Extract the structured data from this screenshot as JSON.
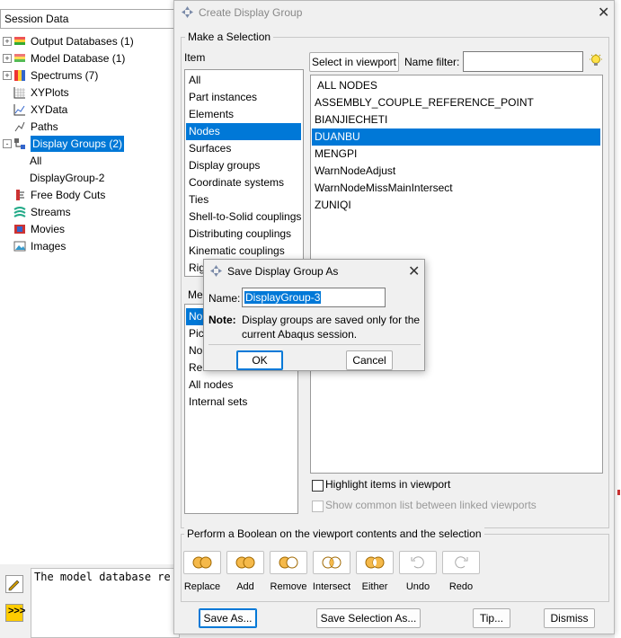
{
  "session": {
    "header": "Session Data",
    "tree": [
      {
        "label": "Output Databases (1)",
        "icon": "database-icon",
        "expand": "+"
      },
      {
        "label": "Model Database (1)",
        "icon": "model-database-icon",
        "expand": "+"
      },
      {
        "label": "Spectrums (7)",
        "icon": "spectrum-icon",
        "expand": "+"
      },
      {
        "label": "XYPlots",
        "icon": "xyplot-icon",
        "expand": ""
      },
      {
        "label": "XYData",
        "icon": "xydata-icon",
        "expand": ""
      },
      {
        "label": "Paths",
        "icon": "path-icon",
        "expand": ""
      },
      {
        "label": "Display Groups (2)",
        "icon": "display-groups-icon",
        "expand": "-"
      },
      {
        "label": "All",
        "icon": "",
        "expand": ""
      },
      {
        "label": "DisplayGroup-2",
        "icon": "",
        "expand": ""
      },
      {
        "label": "Free Body Cuts",
        "icon": "free-body-cut-icon",
        "expand": ""
      },
      {
        "label": "Streams",
        "icon": "stream-icon",
        "expand": ""
      },
      {
        "label": "Movies",
        "icon": "movie-icon",
        "expand": ""
      },
      {
        "label": "Images",
        "icon": "image-icon",
        "expand": ""
      }
    ]
  },
  "command": {
    "text": "The model database re"
  },
  "dialog": {
    "title": "Create Display Group",
    "selection_group": "Make a Selection",
    "item_label": "Item",
    "items": [
      "All",
      "Part instances",
      "Elements",
      "Nodes",
      "Surfaces",
      "Display groups",
      "Coordinate systems",
      "Ties",
      "Shell-to-Solid couplings",
      "Distributing couplings",
      "Kinematic couplings",
      "Rig"
    ],
    "selected_item": "Nodes",
    "method_label": "Me",
    "methods": [
      "No",
      "Pic",
      "No",
      "Re",
      "All nodes",
      "Internal sets"
    ],
    "select_viewport_btn": "Select in viewport",
    "name_filter_label": "Name filter:",
    "name_filter_value": "",
    "node_sets": [
      "ALL NODES",
      "ASSEMBLY_COUPLE_REFERENCE_POINT",
      "BIANJIECHETI",
      "DUANBU",
      "MENGPI",
      "WarnNodeAdjust",
      "WarnNodeMissMainIntersect",
      "ZUNIQI"
    ],
    "selected_node_set": "DUANBU",
    "highlight_label": "Highlight items in viewport",
    "common_list_label": "Show common list between linked viewports",
    "boolean_group": "Perform a Boolean on the viewport contents and the selection",
    "boolean_ops": [
      "Replace",
      "Add",
      "Remove",
      "Intersect",
      "Either",
      "Undo",
      "Redo"
    ],
    "buttons": {
      "save_as": "Save As...",
      "save_selection_as": "Save Selection As...",
      "tip": "Tip...",
      "dismiss": "Dismiss"
    }
  },
  "save_dialog": {
    "title": "Save Display Group As",
    "name_label": "Name:",
    "name_value": "DisplayGroup-3",
    "note_label": "Note:",
    "note_line1": "Display groups are saved only for the",
    "note_line2": "current Abaqus session.",
    "ok": "OK",
    "cancel": "Cancel"
  },
  "colors": {
    "selection": "#0078d7",
    "window_bg": "#f0f0f0"
  }
}
